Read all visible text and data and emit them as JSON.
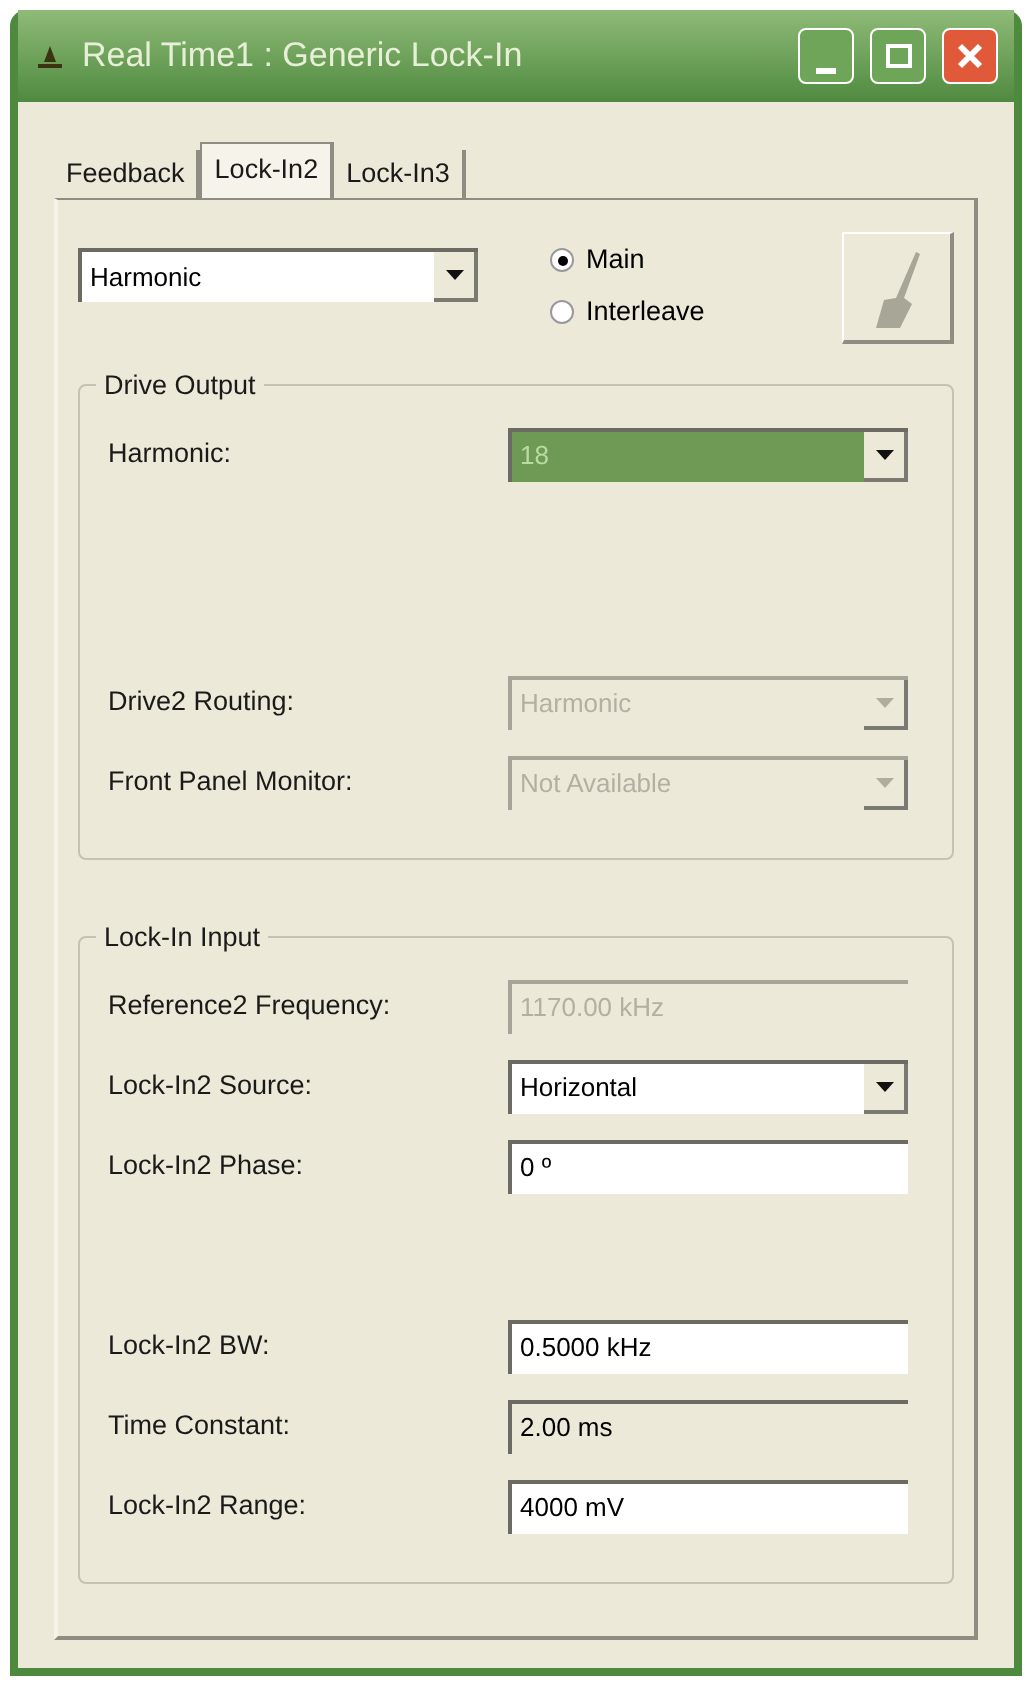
{
  "window": {
    "title": "Real Time1 : Generic Lock-In"
  },
  "tabs": [
    {
      "label": "Feedback",
      "selected": false
    },
    {
      "label": "Lock-In2",
      "selected": true
    },
    {
      "label": "Lock-In3",
      "selected": false
    }
  ],
  "mode_select": {
    "value": "Harmonic"
  },
  "radios": [
    {
      "label": "Main",
      "selected": true
    },
    {
      "label": "Interleave",
      "selected": false
    }
  ],
  "drive_output": {
    "title": "Drive Output",
    "rows": [
      {
        "label": "Harmonic:",
        "kind": "dropdown",
        "value": "18",
        "disabled": false,
        "highlighted": true
      },
      {
        "label": "Drive2 Routing:",
        "kind": "dropdown",
        "value": "Harmonic",
        "disabled": true,
        "highlighted": false
      },
      {
        "label": "Front Panel Monitor:",
        "kind": "dropdown",
        "value": "Not Available",
        "disabled": true,
        "highlighted": false
      }
    ]
  },
  "lock_in_input": {
    "title": "Lock-In Input",
    "rows": [
      {
        "label": "Reference2 Frequency:",
        "kind": "field",
        "value": "1170.00 kHz",
        "disabled": true,
        "readonly": true
      },
      {
        "label": "Lock-In2 Source:",
        "kind": "dropdown",
        "value": "Horizontal",
        "disabled": false
      },
      {
        "label": "Lock-In2 Phase:",
        "kind": "field",
        "value": "0 º",
        "disabled": false,
        "readonly": false
      },
      {
        "label": "Lock-In2 BW:",
        "kind": "field",
        "value": "0.5000 kHz",
        "disabled": false,
        "readonly": false
      },
      {
        "label": "Time Constant:",
        "kind": "field",
        "value": "2.00 ms",
        "disabled": false,
        "readonly": true
      },
      {
        "label": "Lock-In2 Range:",
        "kind": "field",
        "value": "4000 mV",
        "disabled": false,
        "readonly": false
      }
    ]
  }
}
